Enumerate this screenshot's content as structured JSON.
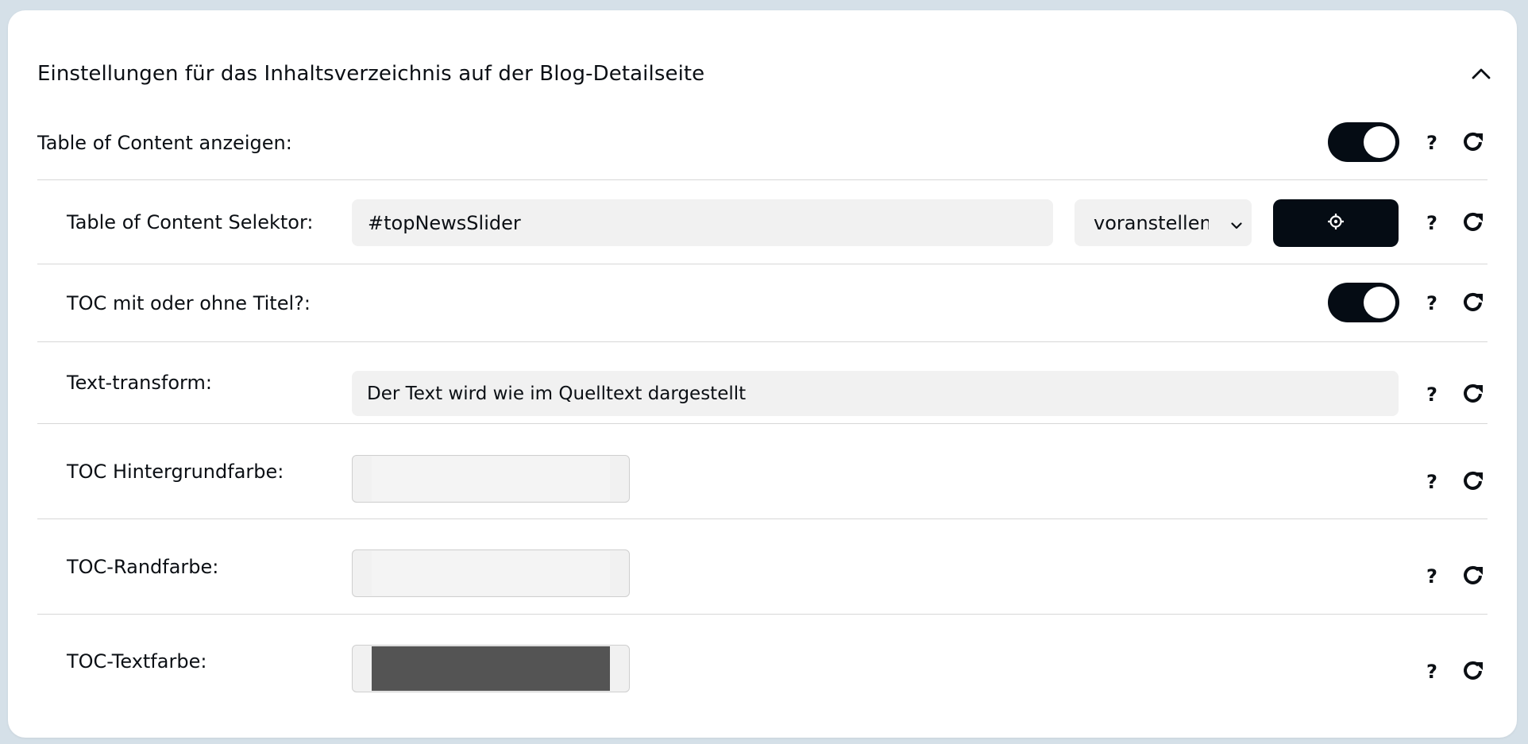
{
  "section": {
    "title": "Einstellungen für das Inhaltsverzeichnis auf der Blog-Detailseite",
    "collapse_icon": "chevron-up-icon"
  },
  "rows": {
    "show_toc": {
      "label": "Table of Content anzeigen:",
      "enabled": true,
      "help": "?"
    },
    "selector": {
      "label": "Table of Content Selektor:",
      "value": "#topNewsSlider",
      "position_option": "voranstellen",
      "picker_icon": "crosshair-icon",
      "help": "?"
    },
    "with_title": {
      "label": "TOC mit oder ohne Titel?:",
      "enabled": true,
      "help": "?"
    },
    "text_transform": {
      "label": "Text-transform:",
      "value": "Der Text wird wie im Quelltext dargestellt",
      "help": "?"
    },
    "bg_color": {
      "label": "TOC Hintergrundfarbe:",
      "color": "#f4f4f4",
      "help": "?"
    },
    "border_color": {
      "label": "TOC-Randfarbe:",
      "color": "#f4f4f4",
      "help": "?"
    },
    "text_color": {
      "label": "TOC-Textfarbe:",
      "color": "#545454",
      "help": "?"
    }
  },
  "colors": {
    "accent": "#050c14",
    "field_bg": "#f1f1f1",
    "page_bg": "#d5e0e8"
  }
}
